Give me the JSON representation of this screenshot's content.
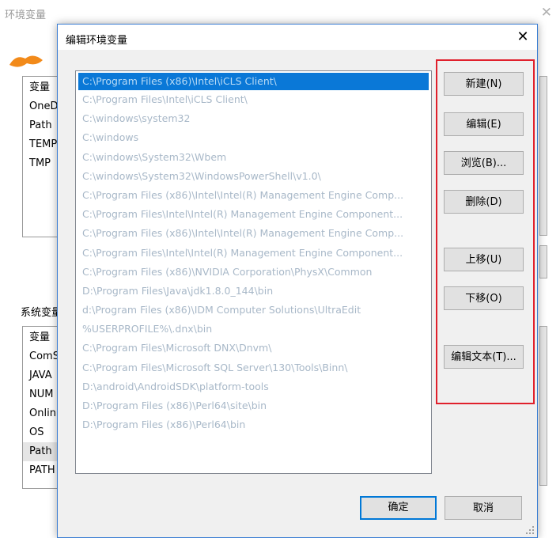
{
  "background_window": {
    "title": "环境变量",
    "user_vars_partial": [
      "变量",
      "OneD",
      "Path",
      "TEMP",
      "TMP"
    ],
    "system_group_label": "系统变量",
    "system_vars_partial": [
      "变量",
      "ComS",
      "JAVA",
      "NUM",
      "Onlin",
      "OS",
      "Path",
      "PATH"
    ]
  },
  "dialog": {
    "title": "编辑环境变量",
    "paths": [
      "C:\\Program Files (x86)\\Intel\\iCLS Client\\",
      "C:\\Program Files\\Intel\\iCLS Client\\",
      "C:\\windows\\system32",
      "C:\\windows",
      "C:\\windows\\System32\\Wbem",
      "C:\\windows\\System32\\WindowsPowerShell\\v1.0\\",
      "C:\\Program Files (x86)\\Intel\\Intel(R) Management Engine Comp...",
      "C:\\Program Files\\Intel\\Intel(R) Management Engine Component...",
      "C:\\Program Files (x86)\\Intel\\Intel(R) Management Engine Comp...",
      "C:\\Program Files\\Intel\\Intel(R) Management Engine Component...",
      "C:\\Program Files (x86)\\NVIDIA Corporation\\PhysX\\Common",
      "D:\\Program Files\\Java\\jdk1.8.0_144\\bin",
      "d:\\Program Files (x86)\\IDM Computer Solutions\\UltraEdit",
      "%USERPROFILE%\\.dnx\\bin",
      "C:\\Program Files\\Microsoft DNX\\Dnvm\\",
      "C:\\Program Files\\Microsoft SQL Server\\130\\Tools\\Binn\\",
      "D:\\android\\AndroidSDK\\platform-tools",
      "D:\\Program Files (x86)\\Perl64\\site\\bin",
      "D:\\Program Files (x86)\\Perl64\\bin"
    ],
    "buttons": {
      "new": "新建(N)",
      "edit": "编辑(E)",
      "browse": "浏览(B)...",
      "delete": "删除(D)",
      "move_up": "上移(U)",
      "move_down": "下移(O)",
      "edit_text": "编辑文本(T)...",
      "ok": "确定",
      "cancel": "取消"
    },
    "close_glyph": "✕"
  },
  "colors": {
    "selection": "#0a78d7",
    "highlight_box": "#e0202c",
    "primary_border": "#0078d7"
  }
}
